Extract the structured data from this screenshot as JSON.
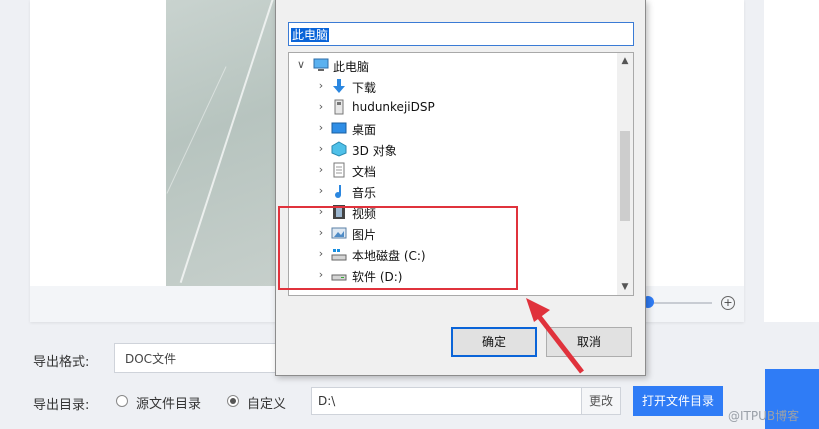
{
  "export": {
    "format_label": "导出格式:",
    "format_value": "DOC文件",
    "dir_label": "导出目录:",
    "radio_source": "源文件目录",
    "radio_custom": "自定义",
    "path_value": "D:\\",
    "change_btn": "更改",
    "open_btn": "打开文件目录"
  },
  "dialog": {
    "folder_value": "此电脑",
    "tree": [
      {
        "label": "此电脑",
        "icon": "computer-icon",
        "expanded": true
      },
      {
        "label": "下载",
        "icon": "download-icon"
      },
      {
        "label": "hudunkejiDSP",
        "icon": "drive-icon"
      },
      {
        "label": "桌面",
        "icon": "desktop-icon"
      },
      {
        "label": "3D 对象",
        "icon": "3d-objects-icon"
      },
      {
        "label": "文档",
        "icon": "document-icon"
      },
      {
        "label": "音乐",
        "icon": "music-icon"
      },
      {
        "label": "视频",
        "icon": "video-icon"
      },
      {
        "label": "图片",
        "icon": "picture-icon"
      },
      {
        "label": "本地磁盘 (C:)",
        "icon": "system-drive-icon"
      },
      {
        "label": "软件 (D:)",
        "icon": "disk-drive-icon"
      }
    ],
    "ok": "确定",
    "cancel": "取消"
  },
  "watermark": "@ITPUB博客",
  "colors": {
    "accent": "#2f7cf6",
    "highlight": "#e0323c",
    "selection": "#0a64d8"
  }
}
